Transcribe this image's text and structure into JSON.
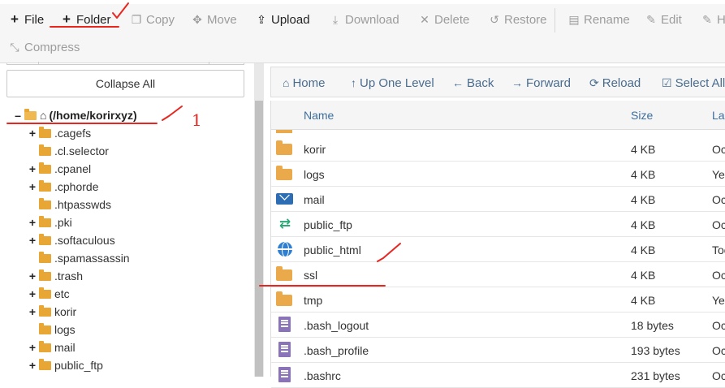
{
  "toolbar": {
    "row1": [
      {
        "key": "file",
        "label": "File",
        "icon": "plus-icon",
        "enabled": true
      },
      {
        "key": "folder",
        "label": "Folder",
        "icon": "plus-icon",
        "enabled": true
      },
      {
        "key": "copy",
        "label": "Copy",
        "icon": "copy-icon",
        "enabled": false
      },
      {
        "key": "move",
        "label": "Move",
        "icon": "move-icon",
        "enabled": false
      },
      {
        "key": "upload",
        "label": "Upload",
        "icon": "upload-icon",
        "enabled": true
      },
      {
        "key": "download",
        "label": "Download",
        "icon": "download-icon",
        "enabled": false
      },
      {
        "key": "delete",
        "label": "Delete",
        "icon": "delete-icon",
        "enabled": false
      },
      {
        "key": "restore",
        "label": "Restore",
        "icon": "restore-icon",
        "enabled": false
      },
      {
        "key": "rename",
        "label": "Rename",
        "icon": "rename-icon",
        "enabled": false
      },
      {
        "key": "edit",
        "label": "Edit",
        "icon": "edit-icon",
        "enabled": false
      },
      {
        "key": "html-editor",
        "label": "H",
        "icon": "html-editor-icon",
        "enabled": false
      }
    ],
    "row2": [
      {
        "key": "compress",
        "label": "Compress",
        "icon": "compress-icon",
        "enabled": false
      }
    ]
  },
  "left_panel": {
    "collapse_label": "Collapse All",
    "root": {
      "label": "(/home/korirxyz)",
      "toggle": "–"
    },
    "tree": [
      {
        "label": ".cagefs",
        "expandable": true
      },
      {
        "label": ".cl.selector",
        "expandable": false
      },
      {
        "label": ".cpanel",
        "expandable": true
      },
      {
        "label": ".cphorde",
        "expandable": true
      },
      {
        "label": ".htpasswds",
        "expandable": false
      },
      {
        "label": ".pki",
        "expandable": true
      },
      {
        "label": ".softaculous",
        "expandable": true
      },
      {
        "label": ".spamassassin",
        "expandable": false
      },
      {
        "label": ".trash",
        "expandable": true
      },
      {
        "label": "etc",
        "expandable": true
      },
      {
        "label": "korir",
        "expandable": true
      },
      {
        "label": "logs",
        "expandable": false
      },
      {
        "label": "mail",
        "expandable": true
      },
      {
        "label": "public_ftp",
        "expandable": true
      }
    ]
  },
  "nav": [
    {
      "key": "home",
      "label": "Home",
      "icon": "home-icon"
    },
    {
      "key": "up",
      "label": "Up One Level",
      "icon": "level-up-icon"
    },
    {
      "key": "back",
      "label": "Back",
      "icon": "arrow-left-icon"
    },
    {
      "key": "forward",
      "label": "Forward",
      "icon": "arrow-right-icon"
    },
    {
      "key": "reload",
      "label": "Reload",
      "icon": "reload-icon"
    },
    {
      "key": "select-all",
      "label": "Select All",
      "icon": "checkbox-icon"
    }
  ],
  "table": {
    "columns": {
      "name": "Name",
      "size": "Size",
      "last": "Las"
    },
    "rows": [
      {
        "name": "korir",
        "size": "4 KB",
        "modified": "Oc",
        "icon": "folder"
      },
      {
        "name": "logs",
        "size": "4 KB",
        "modified": "Yes",
        "icon": "folder"
      },
      {
        "name": "mail",
        "size": "4 KB",
        "modified": "Oc",
        "icon": "mail"
      },
      {
        "name": "public_ftp",
        "size": "4 KB",
        "modified": "Oc",
        "icon": "ftp"
      },
      {
        "name": "public_html",
        "size": "4 KB",
        "modified": "Too",
        "icon": "globe"
      },
      {
        "name": "ssl",
        "size": "4 KB",
        "modified": "Oc",
        "icon": "folder"
      },
      {
        "name": "tmp",
        "size": "4 KB",
        "modified": "Yes",
        "icon": "folder"
      },
      {
        "name": ".bash_logout",
        "size": "18 bytes",
        "modified": "Oc",
        "icon": "file"
      },
      {
        "name": ".bash_profile",
        "size": "193 bytes",
        "modified": "Oc",
        "icon": "file"
      },
      {
        "name": ".bashrc",
        "size": "231 bytes",
        "modified": "Oc",
        "icon": "file"
      }
    ]
  },
  "annotations": {
    "step_number": "1"
  },
  "colors": {
    "annotation_red": "#e8261f",
    "link_blue": "#3b6e9e",
    "folder_orange": "#e8a635"
  }
}
